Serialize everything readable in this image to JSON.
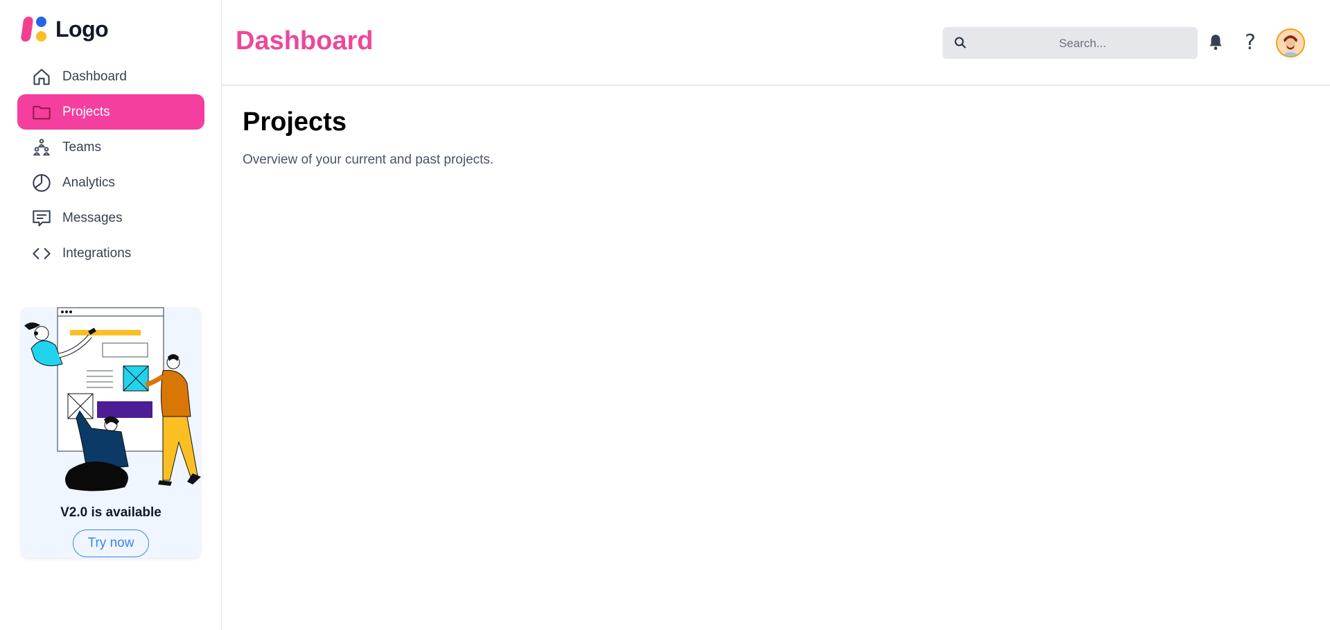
{
  "logo": {
    "text": "Logo"
  },
  "sidebar": {
    "items": [
      {
        "label": "Dashboard",
        "icon": "home-icon",
        "active": false
      },
      {
        "label": "Projects",
        "icon": "folder-icon",
        "active": true
      },
      {
        "label": "Teams",
        "icon": "team-icon",
        "active": false
      },
      {
        "label": "Analytics",
        "icon": "pie-chart-icon",
        "active": false
      },
      {
        "label": "Messages",
        "icon": "message-icon",
        "active": false
      },
      {
        "label": "Integrations",
        "icon": "code-icon",
        "active": false
      }
    ],
    "promo": {
      "title": "V2.0 is available",
      "button": "Try now"
    }
  },
  "header": {
    "title": "Dashboard",
    "search": {
      "placeholder": "Search...",
      "value": ""
    },
    "icons": [
      "search-icon",
      "bell-icon",
      "help-icon",
      "avatar"
    ]
  },
  "main": {
    "heading": "Projects",
    "description": "Overview of your current and past projects."
  },
  "colors": {
    "accent": "#f43f9e",
    "title": "#ec4899",
    "link": "#3b82f6"
  }
}
